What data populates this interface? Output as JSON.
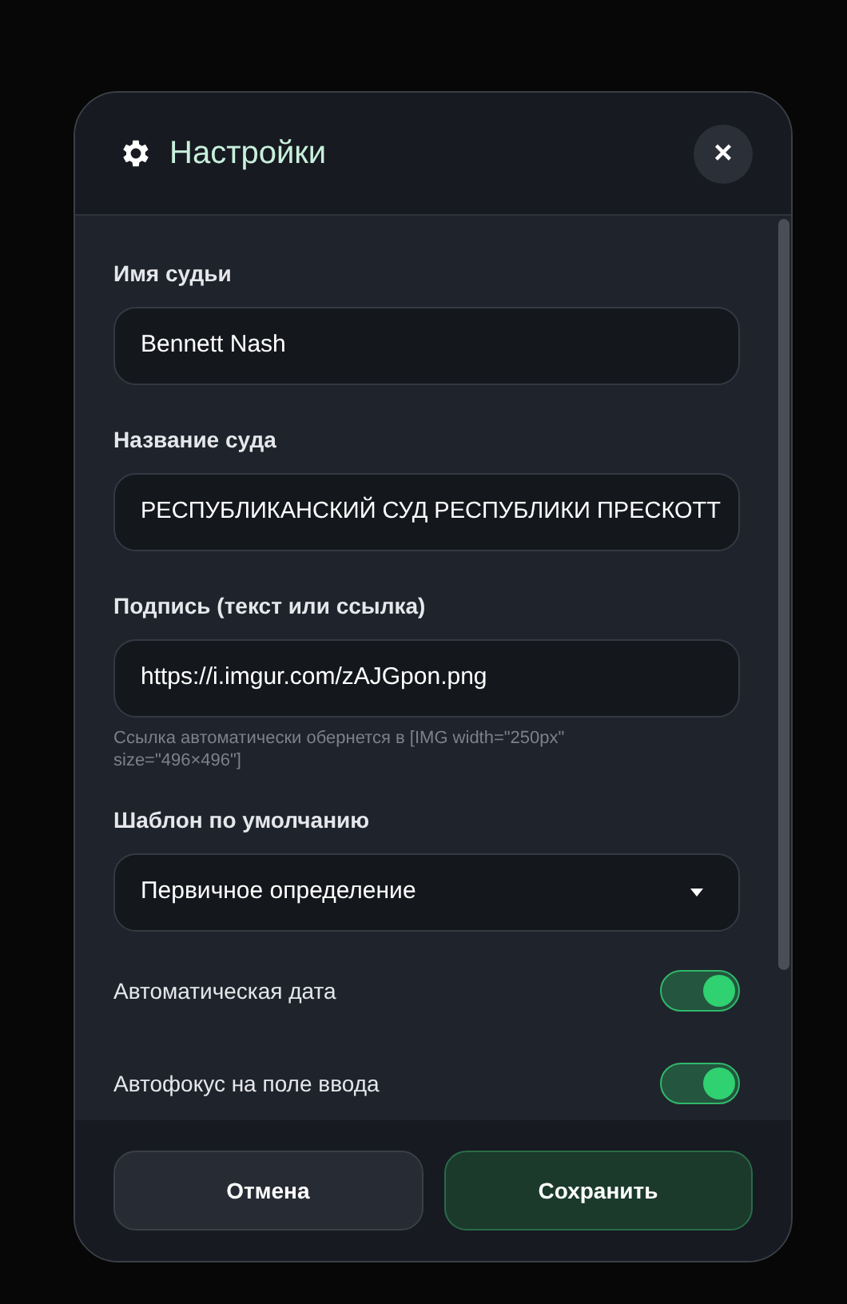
{
  "dialog": {
    "title": "Настройки",
    "close": "×"
  },
  "fields": [
    {
      "kind": "text",
      "label": "Имя судьи",
      "value": "Bennett Nash"
    },
    {
      "kind": "text",
      "label": "Название суда",
      "value": "РЕСПУБЛИКАНСКИЙ СУД РЕСПУБЛИКИ ПРЕСКОТТ"
    },
    {
      "kind": "text",
      "label": "Подпись (текст или ссылка)",
      "value": "https://i.imgur.com/zAJGpon.png",
      "hint": "Ссылка автоматически обернется в [IMG width=\"250px\" size=\"496×496\"]"
    },
    {
      "kind": "select",
      "label": "Шаблон по умолчанию",
      "value": "Первичное определение"
    },
    {
      "kind": "toggle",
      "label": "Автоматическая дата",
      "on": true
    },
    {
      "kind": "toggle",
      "label": "Автофокус на поле ввода",
      "on": true
    }
  ],
  "buttons": [
    {
      "label": "Отмена",
      "kind": "secondary"
    },
    {
      "label": "Сохранить",
      "kind": "primary"
    }
  ]
}
